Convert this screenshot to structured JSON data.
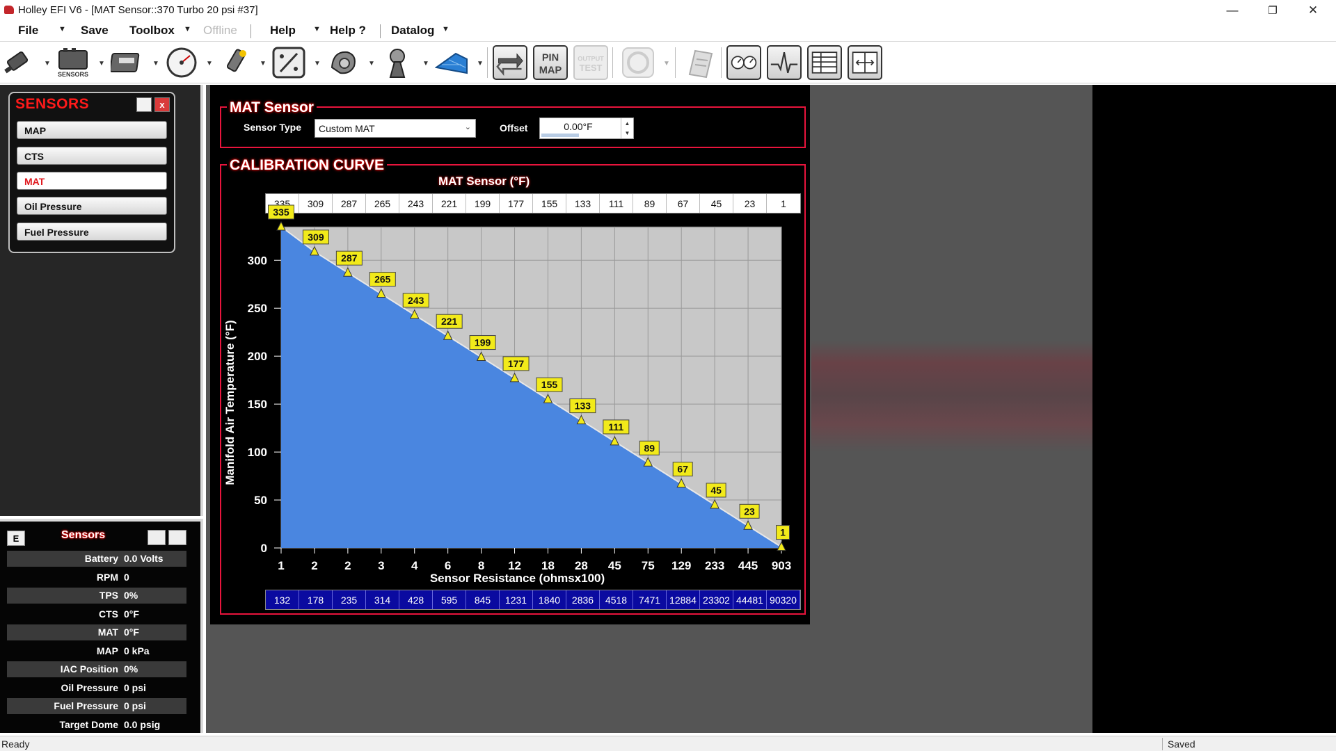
{
  "window": {
    "title": "Holley EFI V6 - [MAT Sensor::370 Turbo 20 psi #37]",
    "minimize": "—",
    "restore": "❐",
    "close": "✕"
  },
  "menu": {
    "file": "File",
    "save": "Save",
    "toolbox": "Toolbox",
    "offline": "Offline",
    "help": "Help",
    "help2": "Help ?",
    "datalog": "Datalog"
  },
  "toolbar": {
    "icons": [
      "injector-icon",
      "sensors-icon",
      "ecu-icon",
      "gauge-icon",
      "ignition-icon",
      "percent-icon",
      "turbo-icon",
      "launch-icon",
      "table-3d-icon",
      "transfer-icon",
      "pin-map-icon",
      "output-test-icon",
      "circle-disabled-icon",
      "notes-icon",
      "dual-gauge-icon",
      "datalog-wave-icon",
      "table-grid-icon",
      "split-view-icon"
    ],
    "sensors_caption": "SENSORS",
    "pin_map_label": "PIN MAP"
  },
  "sensors_panel": {
    "title": "SENSORS",
    "close": "x",
    "items": [
      {
        "label": "MAP",
        "active": false
      },
      {
        "label": "CTS",
        "active": false
      },
      {
        "label": "MAT",
        "active": true
      },
      {
        "label": "Oil Pressure",
        "active": false
      },
      {
        "label": "Fuel Pressure",
        "active": false
      }
    ]
  },
  "datastream": {
    "e_button": "E",
    "title": "Sensors",
    "rows": [
      {
        "label": "Battery",
        "value": "0.0 Volts"
      },
      {
        "label": "RPM",
        "value": "0"
      },
      {
        "label": "TPS",
        "value": "0%"
      },
      {
        "label": "CTS",
        "value": "0°F"
      },
      {
        "label": "MAT",
        "value": "0°F"
      },
      {
        "label": "MAP",
        "value": "0 kPa"
      },
      {
        "label": "IAC Position",
        "value": "0%"
      },
      {
        "label": "Oil Pressure",
        "value": "0 psi"
      },
      {
        "label": "Fuel Pressure",
        "value": "0 psi"
      },
      {
        "label": "Target Dome",
        "value": "0.0 psig"
      }
    ]
  },
  "mat_sensor": {
    "group_title": "MAT Sensor",
    "sensor_type_label": "Sensor Type",
    "sensor_type_value": "Custom MAT",
    "offset_label": "Offset",
    "offset_value": "0.00°F"
  },
  "calibration": {
    "group_title": "CALIBRATION CURVE"
  },
  "colors": {
    "accent_red": "#e8143c",
    "curve_fill": "#4a86e0",
    "plot_bg": "#c8c8c8",
    "label_yellow": "#f2ea1a"
  },
  "chart_data": {
    "type": "area",
    "title": "MAT Sensor (°F)",
    "xlabel": "Sensor Resistance (ohmsx100)",
    "ylabel": "Manifold Air Temperature (°F)",
    "x_tick_labels": [
      "1",
      "2",
      "2",
      "3",
      "4",
      "6",
      "8",
      "12",
      "18",
      "28",
      "45",
      "75",
      "129",
      "233",
      "445",
      "903"
    ],
    "y_ticks": [
      0,
      50,
      100,
      150,
      200,
      250,
      300
    ],
    "ylim": [
      0,
      335
    ],
    "temperatures": [
      335,
      309,
      287,
      265,
      243,
      221,
      199,
      177,
      155,
      133,
      111,
      89,
      67,
      45,
      23,
      1
    ],
    "resistances": [
      132,
      178,
      235,
      314,
      428,
      595,
      845,
      1231,
      1840,
      2836,
      4518,
      7471,
      12884,
      23302,
      44481,
      90320
    ],
    "grid": true
  },
  "status": {
    "left": "Ready",
    "right": "Saved"
  }
}
